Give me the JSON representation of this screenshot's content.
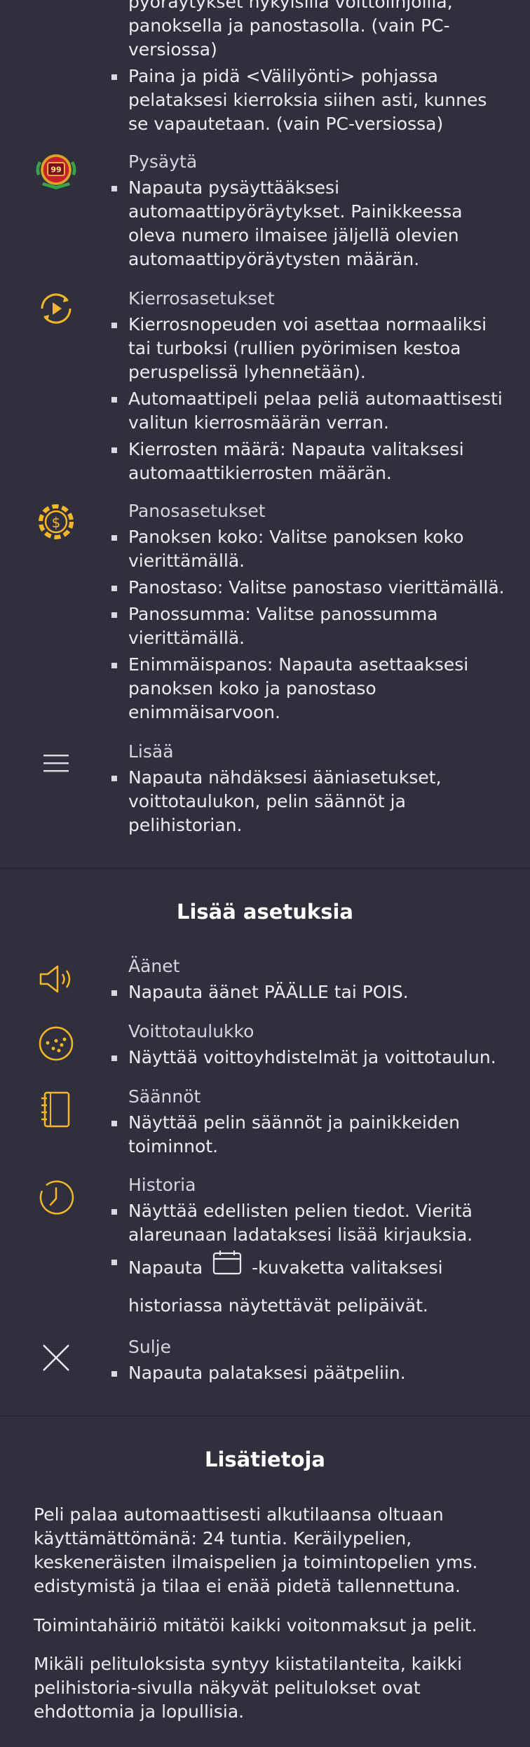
{
  "top": {
    "continuation_lines": [
      "pyöräytykset nykyisillä voittolinjoilla,",
      "panoksella ja panostasolla. (vain PC-",
      "versiossa)"
    ],
    "space_hold_item": "Paina ja pidä <Välilyönti> pohjassa pelataksesi kierroksia siihen asti, kunnes se vapautetaan. (vain PC-versiossa)"
  },
  "controls": [
    {
      "icon": "stop-autospin-icon",
      "title": "Pysäytä",
      "items": [
        "Napauta pysäyttääksesi automaattipyöräytykset. Painikkeessa oleva numero ilmaisee jäljellä olevien automaattipyöräytysten määrän."
      ],
      "stop_badge": "99"
    },
    {
      "icon": "spin-settings-icon",
      "title": "Kierrosasetukset",
      "items": [
        "Kierrosnopeuden voi asettaa normaaliksi tai turboksi (rullien pyörimisen kestoa peruspelissä lyhennetään).",
        "Automaattipeli pelaa peliä automaattisesti valitun kierrosmäärän verran.",
        "Kierrosten määrä: Napauta valitaksesi automaattikierrosten määrän."
      ]
    },
    {
      "icon": "bet-settings-icon",
      "title": "Panosasetukset",
      "items": [
        "Panoksen koko: Valitse panoksen koko vierittämällä.",
        "Panostaso: Valitse panostaso vierittämällä.",
        "Panossumma: Valitse panossumma vierittämällä.",
        "Enimmäispanos: Napauta asettaaksesi panoksen koko ja panostaso enimmäisarvoon."
      ],
      "coin_symbol": "$"
    },
    {
      "icon": "menu-icon",
      "title": "Lisää",
      "items": [
        "Napauta nähdäksesi ääniasetukset, voittotaulukon, pelin säännöt ja pelihistorian."
      ]
    }
  ],
  "more_settings": {
    "heading": "Lisää asetuksia",
    "entries": [
      {
        "icon": "sound-icon",
        "title": "Äänet",
        "items": [
          "Napauta äänet PÄÄLLE tai POIS."
        ]
      },
      {
        "icon": "paytable-icon",
        "title": "Voittotaulukko",
        "items": [
          "Näyttää voittoyhdistelmät ja voittotaulun."
        ]
      },
      {
        "icon": "rules-icon",
        "title": "Säännöt",
        "items": [
          "Näyttää pelin säännöt ja painikkeiden toiminnot."
        ]
      },
      {
        "icon": "history-icon",
        "title": "Historia",
        "items": [
          "Näyttää edellisten pelien tiedot. Vieritä alareunaan ladataksesi lisää kirjauksia."
        ],
        "calendar_item_before": "Napauta",
        "calendar_item_after": "-kuvaketta valitaksesi",
        "calendar_item_line2": "historiassa näytettävät pelipäivät."
      },
      {
        "icon": "close-icon",
        "title": "Sulje",
        "items": [
          "Napauta palataksesi päätpeliin."
        ]
      }
    ]
  },
  "additional_info": {
    "heading": "Lisätietoja",
    "paragraphs": [
      "Peli palaa automaattisesti alkutilaansa oltuaan käyttämättömänä: 24 tuntia. Keräilypelien, keskeneräisten ilmaispelien ja toimintopelien yms. edistymistä ja tilaa ei enää pidetä tallennettuna.",
      "Toimintahäiriö mitätöi kaikki voitonmaksut ja pelit.",
      "Mikäli pelituloksista syntyy kiistatilanteita, kaikki pelihistoria-sivulla näkyvät pelitulokset ovat ehdottomia ja lopullisia."
    ]
  },
  "colors": {
    "accent": "#f5b62a",
    "background": "#30303c",
    "stop_red": "#c8202a",
    "stop_green": "#3aa24a"
  }
}
